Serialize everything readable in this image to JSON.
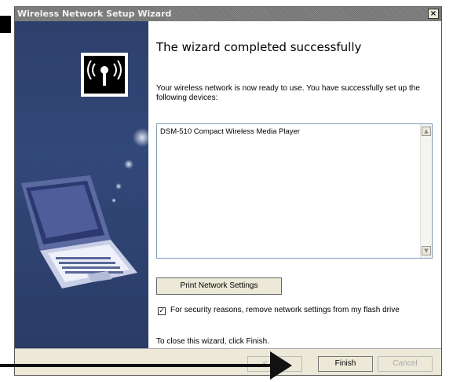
{
  "window": {
    "title": "Wireless Network Setup Wizard",
    "close_glyph": "×"
  },
  "content": {
    "heading": "The wizard completed successfully",
    "description": "Your wireless network is now ready to use. You have successfully set up the following devices:",
    "devices": [
      "DSM-510 Compact Wireless Media Player"
    ],
    "print_button": "Print Network Settings",
    "checkbox_checked": true,
    "checkbox_label": "For security reasons, remove network settings from my flash drive",
    "close_hint": "To close this wizard, click Finish."
  },
  "footer": {
    "back": "< Back",
    "finish": "Finish",
    "cancel": "Cancel"
  },
  "colors": {
    "sidebar": "#2d3f6b",
    "arrow": "#111111"
  },
  "icons": [
    "wireless-antenna-icon",
    "laptop-illustration",
    "scroll-up-arrow-icon",
    "scroll-down-arrow-icon",
    "check-icon",
    "pointer-arrow"
  ]
}
